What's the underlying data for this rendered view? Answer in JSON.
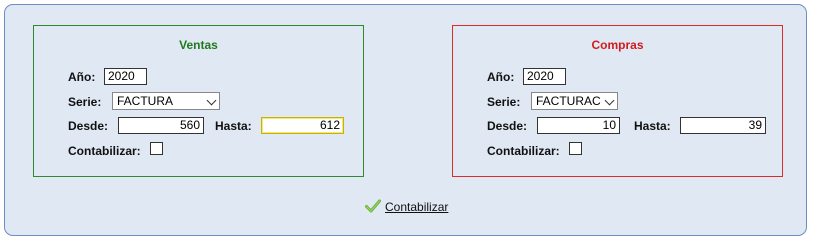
{
  "ventas": {
    "title": "Ventas",
    "year_label": "Año:",
    "year_value": "2020",
    "serie_label": "Serie:",
    "serie_value": "FACTURA",
    "desde_label": "Desde:",
    "desde_value": "560",
    "hasta_label": "Hasta:",
    "hasta_value": "612",
    "contabilizar_label": "Contabilizar:",
    "contabilizar_checked": false
  },
  "compras": {
    "title": "Compras",
    "year_label": "Año:",
    "year_value": "2020",
    "serie_label": "Serie:",
    "serie_value": "FACTURAC",
    "desde_label": "Desde:",
    "desde_value": "10",
    "hasta_label": "Hasta:",
    "hasta_value": "39",
    "contabilizar_label": "Contabilizar:",
    "contabilizar_checked": false
  },
  "action": {
    "label": "Contabilizar",
    "icon": "checkmark-icon"
  },
  "colors": {
    "ventas_accent": "#1f7a1f",
    "compras_accent": "#d01c1c",
    "panel_bg": "#dfe8f3",
    "check_green": "#6ab43a"
  }
}
